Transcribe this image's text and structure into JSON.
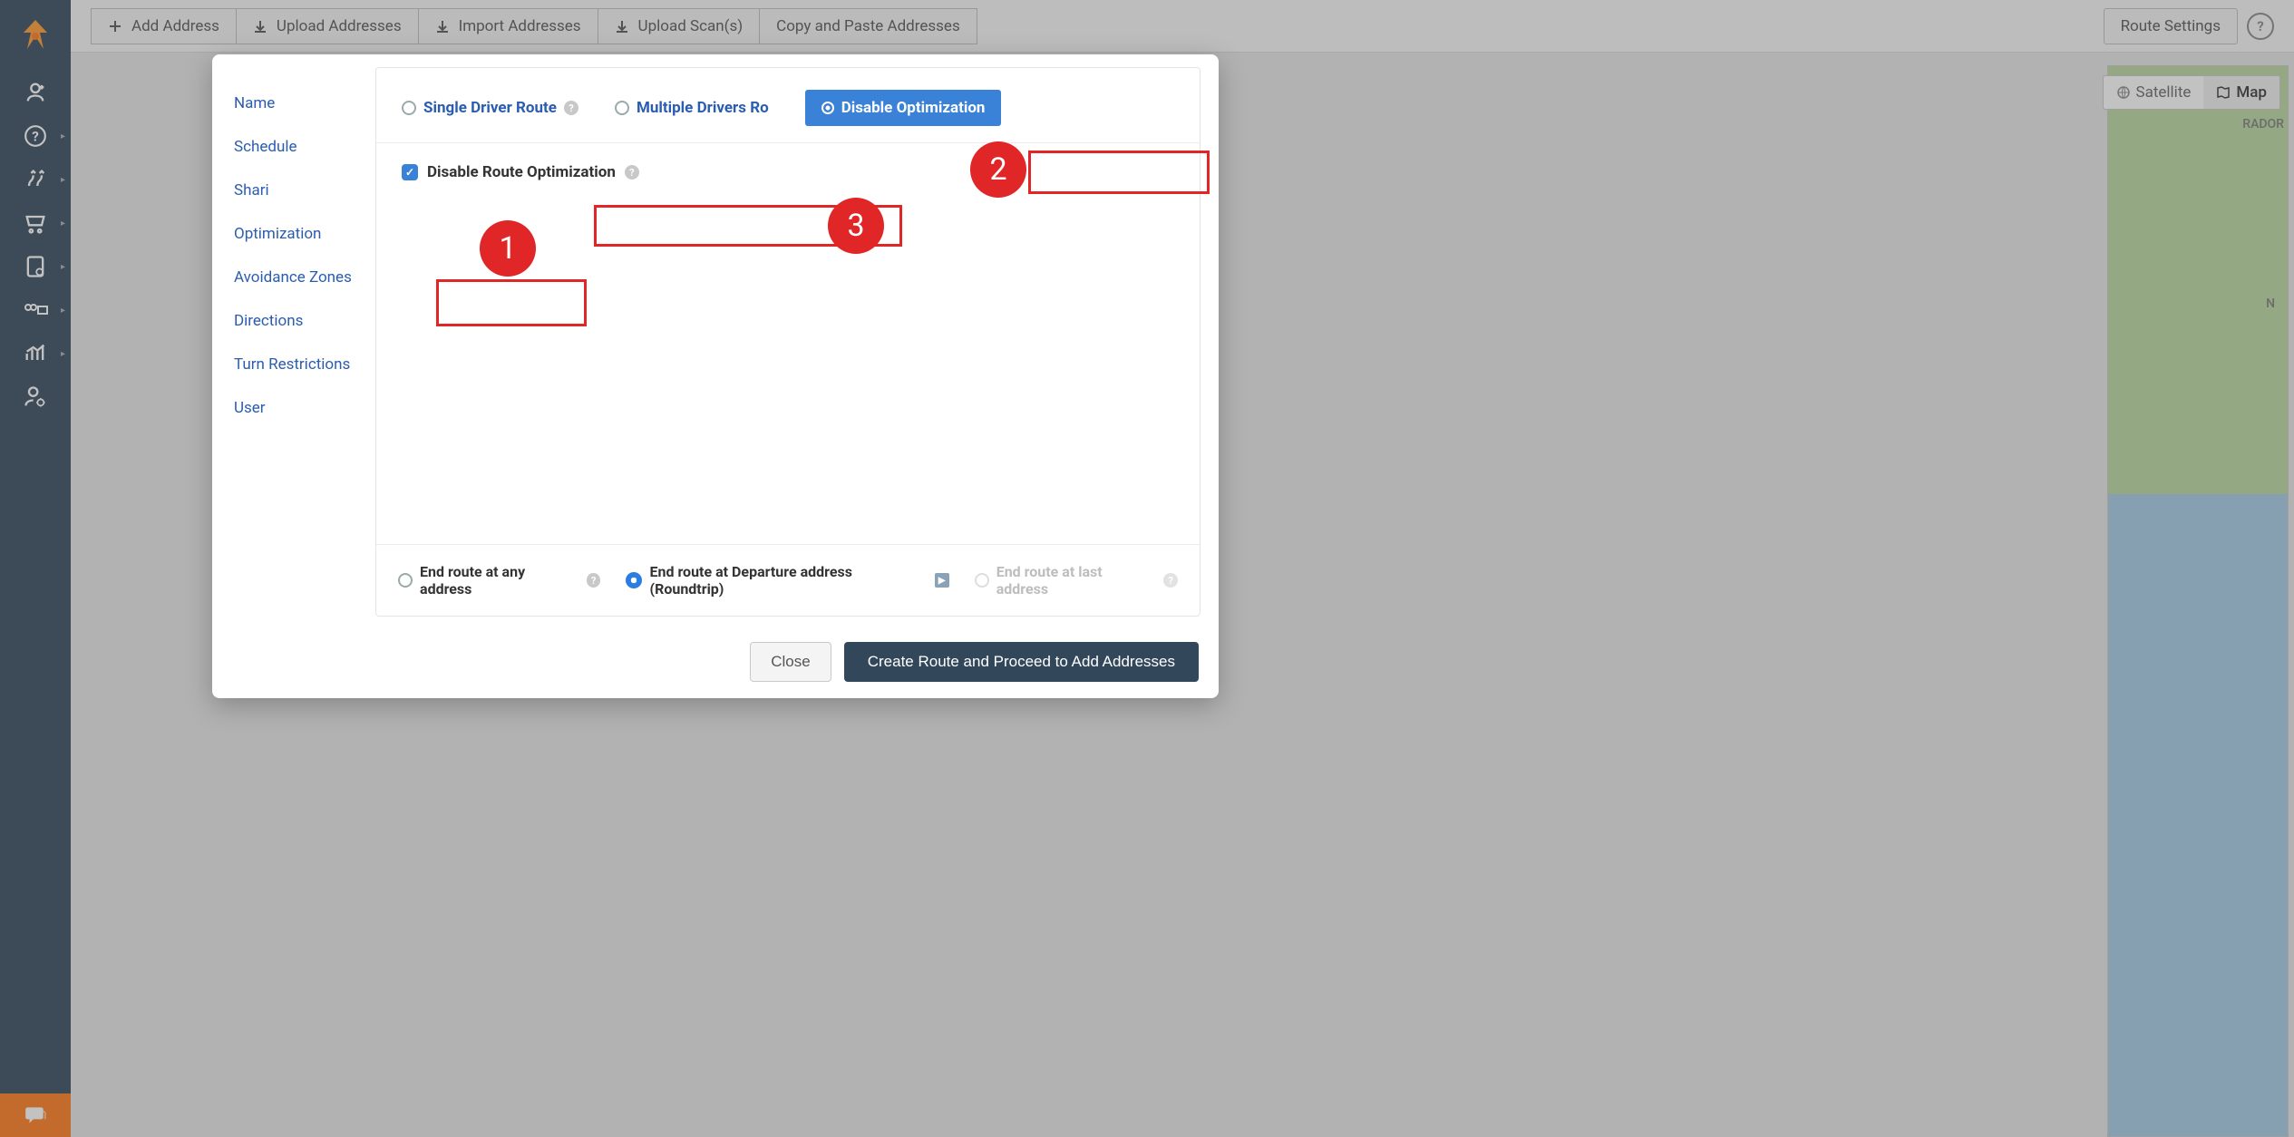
{
  "toolbar": {
    "add_address": "Add Address",
    "upload_addresses": "Upload Addresses",
    "import_addresses": "Import Addresses",
    "upload_scans": "Upload Scan(s)",
    "copy_paste": "Copy and Paste Addresses",
    "route_settings": "Route Settings"
  },
  "map": {
    "satellite": "Satellite",
    "map": "Map",
    "label1": "RADOR",
    "label2": "N"
  },
  "modal": {
    "nav": {
      "name": "Name",
      "schedule": "Schedule",
      "sharing": "Shari",
      "optimization": "Optimization",
      "avoidance": "Avoidance Zones",
      "directions": "Directions",
      "turn_restrictions": "Turn Restrictions",
      "user": "User"
    },
    "tabs": {
      "single": "Single Driver Route",
      "multiple": "Multiple Drivers Ro",
      "disable": "Disable Optimization"
    },
    "checkbox": "Disable Route Optimization",
    "end_options": {
      "any": "End route at any address",
      "roundtrip": "End route at Departure address (Roundtrip)",
      "last": "End route at last address"
    },
    "footer": {
      "close": "Close",
      "submit": "Create Route and Proceed to Add Addresses"
    }
  },
  "callouts": {
    "c1": "1",
    "c2": "2",
    "c3": "3"
  }
}
